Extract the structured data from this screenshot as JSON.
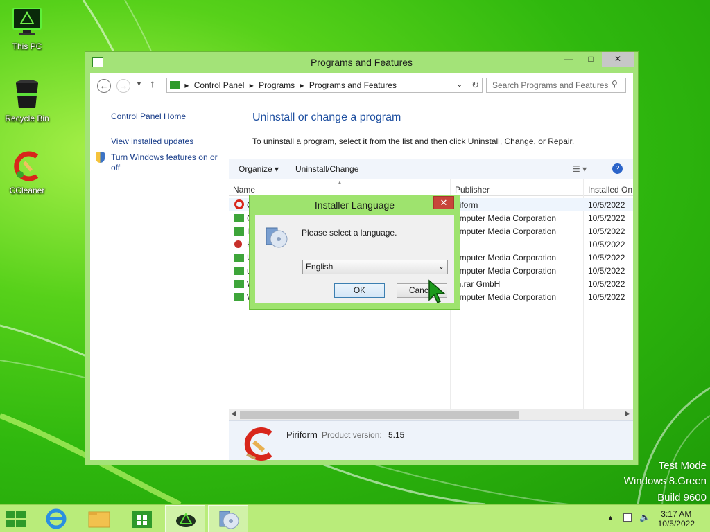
{
  "desktop": {
    "icons": [
      {
        "label": "This PC"
      },
      {
        "label": "Recycle Bin"
      },
      {
        "label": "CCleaner"
      }
    ],
    "watermark": [
      "Test Mode",
      "Windows 8.Green",
      "Build 9600"
    ]
  },
  "window": {
    "title": "Programs and Features",
    "breadcrumb": [
      "Control Panel",
      "Programs",
      "Programs and Features"
    ],
    "search_placeholder": "Search Programs and Features",
    "left_links": [
      "Control Panel Home",
      "View installed updates",
      "Turn Windows features on or off"
    ],
    "heading": "Uninstall or change a program",
    "description": "To uninstall a program, select it from the list and then click Uninstall, Change, or Repair.",
    "toolbar": {
      "organize": "Organize",
      "uninstall_change": "Uninstall/Change"
    },
    "columns": {
      "name": "Name",
      "publisher": "Publisher",
      "installed_on": "Installed On"
    },
    "rows": [
      {
        "name": "C",
        "publisher": "iriform",
        "installed": "10/5/2022"
      },
      {
        "name": "C",
        "publisher": "omputer Media Corporation",
        "installed": "10/5/2022"
      },
      {
        "name": "I",
        "publisher": "omputer Media Corporation",
        "installed": "10/5/2022"
      },
      {
        "name": "K",
        "publisher": "",
        "installed": "10/5/2022"
      },
      {
        "name": "U",
        "publisher": "omputer Media Corporation",
        "installed": "10/5/2022"
      },
      {
        "name": "u",
        "publisher": "omputer Media Corporation",
        "installed": "10/5/2022"
      },
      {
        "name": "W",
        "publisher": "in.rar GmbH",
        "installed": "10/5/2022"
      },
      {
        "name": "W",
        "publisher": "omputer Media Corporation",
        "installed": "10/5/2022"
      }
    ],
    "details": {
      "publisher": "Piriform",
      "version_label": "Product version:",
      "version": "5.15"
    }
  },
  "dialog": {
    "title": "Installer Language",
    "prompt": "Please select a language.",
    "selected_language": "English",
    "ok": "OK",
    "cancel": "Cancel"
  },
  "taskbar": {
    "time": "3:17 AM",
    "date": "10/5/2022"
  },
  "colors": {
    "accent_green": "#9ee36e",
    "link_blue": "#1a3e8a",
    "close_red": "#c7453a"
  }
}
